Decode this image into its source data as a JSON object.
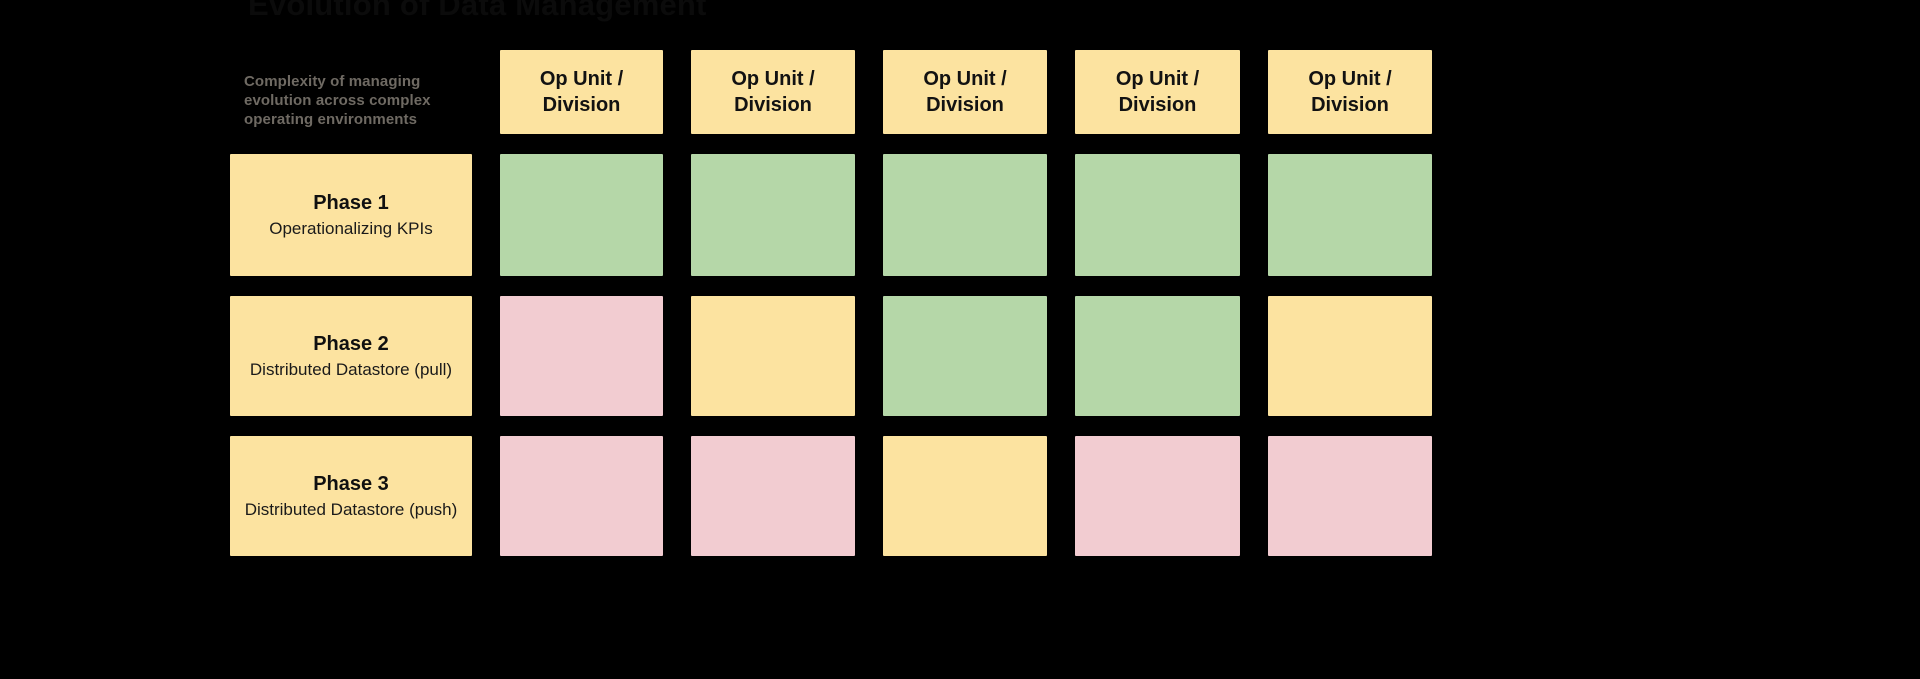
{
  "title": "Evolution of Data Management",
  "corner": {
    "description": "Complexity of managing evolution across complex operating environments"
  },
  "colors": {
    "background": "#000000",
    "header_fill": "#fce3a0",
    "green": "#b5d7a8",
    "yellow": "#fce3a0",
    "pink": "#f2ccd1",
    "title_text": "#0b0b0b",
    "corner_text": "#6f6a63"
  },
  "columns": [
    {
      "label": "Op Unit / Division"
    },
    {
      "label": "Op Unit / Division"
    },
    {
      "label": "Op Unit / Division"
    },
    {
      "label": "Op Unit / Division"
    },
    {
      "label": "Op Unit / Division"
    }
  ],
  "rows": [
    {
      "title": "Phase 1",
      "subtitle": "Operationalizing KPIs",
      "cells": [
        "green",
        "green",
        "green",
        "green",
        "green"
      ]
    },
    {
      "title": "Phase 2",
      "subtitle": "Distributed Datastore (pull)",
      "cells": [
        "pink",
        "yellow",
        "green",
        "green",
        "yellow"
      ]
    },
    {
      "title": "Phase 3",
      "subtitle": "Distributed Datastore (push)",
      "cells": [
        "pink",
        "pink",
        "yellow",
        "pink",
        "pink"
      ]
    }
  ]
}
